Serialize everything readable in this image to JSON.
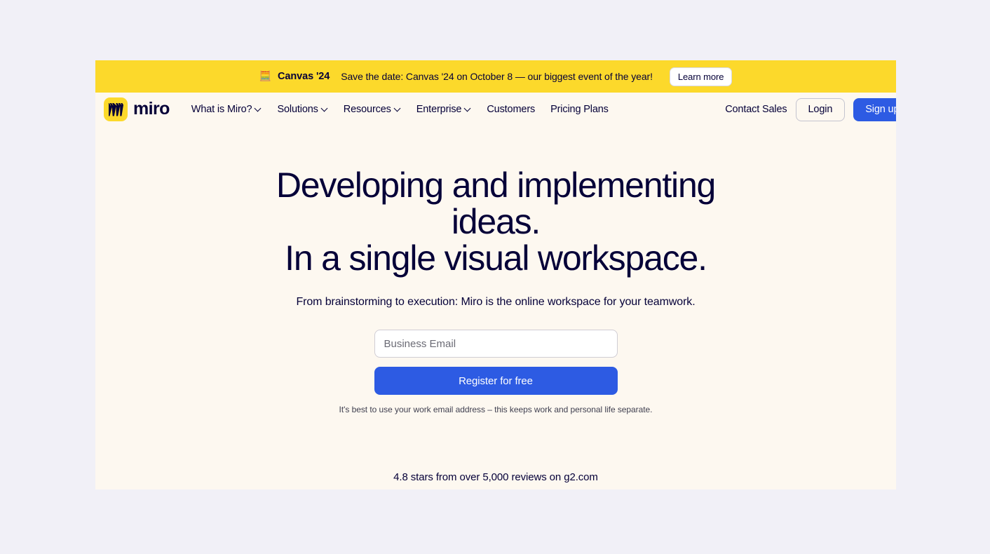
{
  "banner": {
    "icon": "abacus-icon",
    "icon_glyph": "🧮",
    "strong": "Canvas '24",
    "text": "Save the date: Canvas '24 on October 8 — our biggest event of the year!",
    "button_label": "Learn more",
    "background": "#fcd92b"
  },
  "nav": {
    "logo_text": "miro",
    "logo_mark": "miro-m-icon",
    "links": [
      {
        "label": "What is Miro?",
        "has_chevron": true
      },
      {
        "label": "Solutions",
        "has_chevron": true
      },
      {
        "label": "Resources",
        "has_chevron": true
      },
      {
        "label": "Enterprise",
        "has_chevron": true
      },
      {
        "label": "Customers",
        "has_chevron": false
      },
      {
        "label": "Pricing Plans",
        "has_chevron": false
      }
    ],
    "contact_sales": "Contact Sales",
    "login": "Login",
    "signup": "Sign up for free"
  },
  "hero": {
    "title_line1": "Developing and implementing",
    "title_line2": "ideas.",
    "title_line3": "In a single visual workspace.",
    "subtitle": "From brainstorming to execution: Miro is the online workspace for your teamwork.",
    "email_placeholder": "Business Email",
    "email_value": "",
    "cta_label": "Register for free",
    "disclaimer": "It's best to use your work email address – this keeps work and personal life separate.",
    "reviews": "4.8 stars from over 5,000 reviews on g2.com",
    "background": "#fdf8f0"
  },
  "colors": {
    "brand_yellow": "#fcd92b",
    "brand_blue": "#2d5be3",
    "ink": "#050038",
    "page_background": "#f1f0f7"
  }
}
